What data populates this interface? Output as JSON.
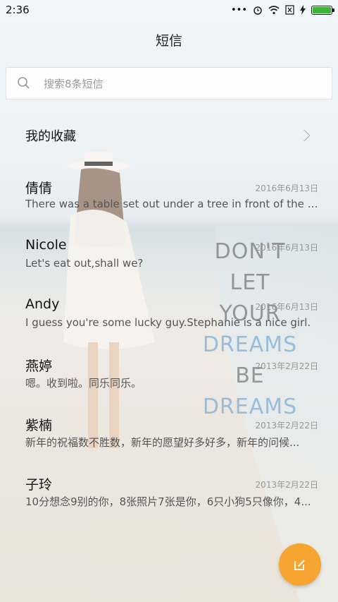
{
  "status": {
    "time": "2:36",
    "icons": [
      "more-dots-icon",
      "alarm-icon",
      "wifi-icon",
      "sim-x-icon",
      "charging-icon",
      "battery-icon"
    ]
  },
  "header": {
    "title": "短信"
  },
  "search": {
    "placeholder": "搜索8条短信"
  },
  "favorites": {
    "label": "我的收藏"
  },
  "conversations": [
    {
      "name": "倩倩",
      "date": "2016年6月13日",
      "preview": "There was a table set out under a tree in front of the ho..."
    },
    {
      "name": "Nicole",
      "date": "2016年6月13日",
      "preview": "Let's eat out,shall we?"
    },
    {
      "name": "Andy",
      "date": "2016年6月13日",
      "preview": "I guess you're some lucky guy.Stephanie is a nice girl."
    },
    {
      "name": "燕婷",
      "date": "2013年2月22日",
      "preview": "嗯。收到啦。同乐同乐。"
    },
    {
      "name": "紫楠",
      "date": "2013年2月22日",
      "preview": "新年的祝福数不胜数，新年的愿望好多好多，新年的问候..."
    },
    {
      "name": "子玲",
      "date": "2013年2月22日",
      "preview": "10分想念9别的你，8张照片7张是你，6只小狗5只像你，4..."
    }
  ],
  "wallpaper_quote": [
    "DON'T",
    "LET",
    "YOUR",
    "DREAMS",
    "BE",
    "DREAMS"
  ],
  "colors": {
    "fab": "#f6a531",
    "battery": "#3cb43c"
  }
}
